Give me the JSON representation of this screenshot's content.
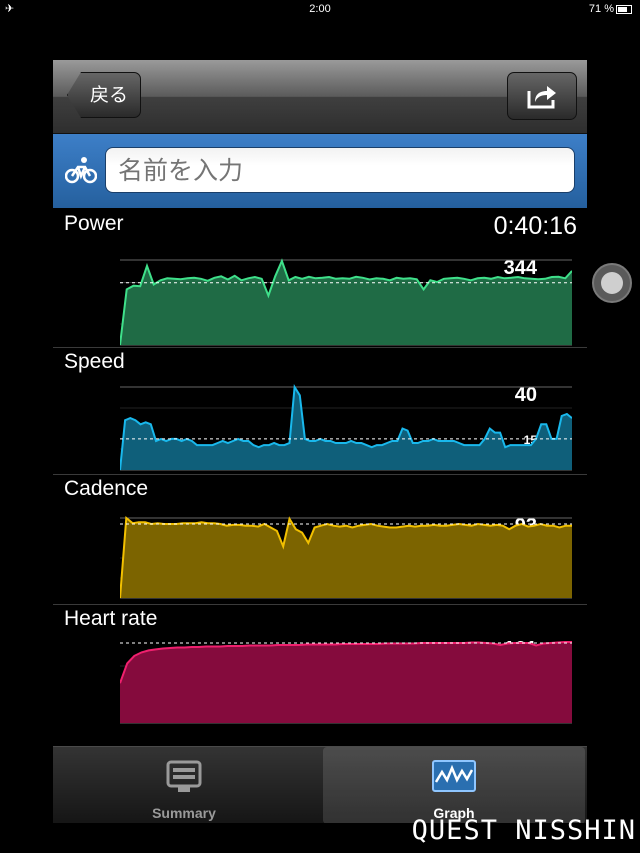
{
  "status": {
    "time": "2:00",
    "battery": "71 %",
    "airplane": "✈",
    "wifi": "⌔"
  },
  "nav": {
    "back_label": "戻る",
    "share_icon": "share-icon"
  },
  "name_field": {
    "placeholder": "名前を入力",
    "value": ""
  },
  "duration": "0:40:16",
  "panels": [
    {
      "title": "Power",
      "max": "344",
      "avg": "252",
      "zero": "0",
      "color": "#3fe08a",
      "fill": "#1f6b45"
    },
    {
      "title": "Speed",
      "max": "40",
      "avg": "15",
      "zero": "0",
      "color": "#19b8ec",
      "fill": "#0f5f7a"
    },
    {
      "title": "Cadence",
      "max": "93",
      "zero": "0",
      "color": "#f2c000",
      "fill": "#7c6400"
    },
    {
      "title": "Heart rate",
      "max": "161",
      "zero": "0",
      "color": "#f0206e",
      "fill": "#850b3d"
    }
  ],
  "series": {
    "power": [
      0,
      225,
      240,
      238,
      320,
      245,
      262,
      270,
      268,
      266,
      270,
      272,
      268,
      260,
      272,
      278,
      265,
      280,
      262,
      270,
      275,
      268,
      200,
      278,
      340,
      262,
      275,
      268,
      276,
      270,
      272,
      275,
      268,
      270,
      268,
      276,
      272,
      265,
      270,
      268,
      262,
      272,
      268,
      270,
      266,
      225,
      262,
      255,
      268,
      270,
      272,
      268,
      262,
      270,
      272,
      268,
      275,
      270,
      272,
      275,
      270,
      268,
      266,
      268,
      275,
      276,
      270,
      300
    ],
    "speed": [
      0,
      24,
      25,
      24,
      22,
      23,
      22,
      14,
      15,
      14,
      15,
      15,
      14,
      15,
      14,
      12,
      12,
      12,
      12,
      13,
      14,
      13,
      14,
      15,
      14,
      14,
      12,
      11,
      12,
      12,
      13,
      12,
      12,
      13,
      40,
      36,
      15,
      14,
      14,
      15,
      14,
      14,
      13,
      13,
      13,
      14,
      13,
      13,
      12,
      11,
      12,
      12,
      13,
      14,
      14,
      20,
      19,
      13,
      13,
      14,
      14,
      15,
      14,
      14,
      14,
      14,
      13,
      12,
      12,
      12,
      12,
      15,
      20,
      18,
      18,
      11,
      12,
      12,
      12,
      12,
      12,
      15,
      22,
      22,
      15,
      15,
      26,
      27,
      25
    ],
    "cadence": [
      0,
      93,
      87,
      88,
      88,
      86,
      87,
      86,
      86,
      86,
      87,
      87,
      87,
      88,
      87,
      87,
      86,
      84,
      85,
      85,
      84,
      84,
      83,
      86,
      82,
      78,
      60,
      92,
      80,
      76,
      64,
      82,
      84,
      86,
      84,
      83,
      84,
      82,
      84,
      85,
      86,
      84,
      83,
      82,
      82,
      83,
      84,
      83,
      84,
      84,
      85,
      84,
      84,
      85,
      86,
      85,
      84,
      86,
      85,
      84,
      85,
      84,
      80,
      84,
      86,
      83,
      84,
      86,
      84,
      84,
      82,
      84,
      84
    ],
    "heart": [
      80,
      120,
      135,
      142,
      146,
      148,
      150,
      151,
      152,
      152,
      153,
      153,
      154,
      154,
      154,
      155,
      155,
      155,
      156,
      156,
      156,
      156,
      157,
      157,
      157,
      157,
      158,
      158,
      158,
      158,
      158,
      159,
      159,
      159,
      159,
      159,
      159,
      160,
      160,
      160,
      160,
      160,
      161,
      161,
      161,
      161,
      161,
      161,
      161,
      162,
      162,
      161,
      160,
      157,
      160,
      161,
      161,
      161,
      156,
      160,
      161,
      162,
      163,
      163
    ]
  },
  "tabs": {
    "summary_label": "Summary",
    "graph_label": "Graph"
  },
  "watermark": "QUEST NISSHIN"
}
